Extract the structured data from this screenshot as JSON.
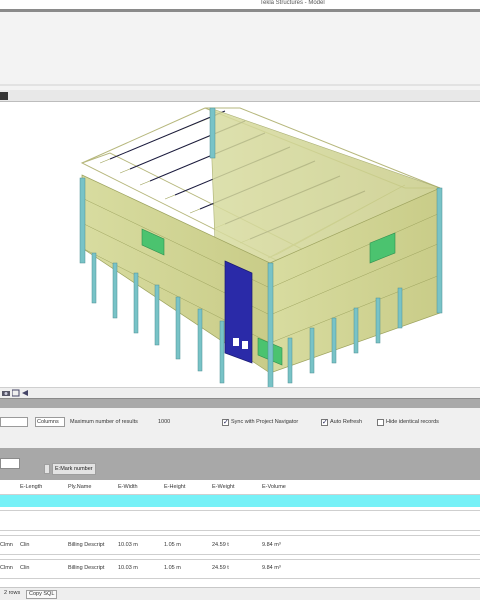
{
  "window": {
    "title": "Tekla Structures - Model"
  },
  "toolbar": {
    "columns_label": "Columns",
    "max_rows_label": "Maximum number of results",
    "max_rows_value": "1000",
    "sync_label": "Sync with Project Navigator",
    "sync_checked": true,
    "auto_refresh_label": "Auto Refresh",
    "auto_refresh_checked": true,
    "hide_identical_label": "Hide identical records",
    "hide_identical_checked": false
  },
  "grouping": {
    "chip_label": "E:Mark number"
  },
  "columns": [
    {
      "label": "E-Length"
    },
    {
      "label": "Ply.Name"
    },
    {
      "label": "E-Width"
    },
    {
      "label": "E-Height"
    },
    {
      "label": "E-Weight"
    },
    {
      "label": "E-Volume"
    }
  ],
  "rows": [
    {
      "col0": "Clmn",
      "col1": "Clin",
      "col2": "Billing Descript",
      "col3": "10.03 m",
      "col4": "1.05 m",
      "col5": "24.59 t",
      "col6": "9.84 m³"
    },
    {
      "col0": "Clmn",
      "col1": "Clin",
      "col2": "Billing Descript",
      "col3": "10.03 m",
      "col4": "1.05 m",
      "col5": "24.59 t",
      "col6": "9.84 m³"
    }
  ],
  "status": {
    "rows_count": "2 rows",
    "copy_sql_label": "Copy SQL"
  },
  "colors": {
    "frame_panel": "#d6d99a",
    "frame_edge": "#9da35e",
    "column": "#78c3c7",
    "blue_panel": "#2a2aa8",
    "green_panel": "#4bc36f",
    "filter_row": "#77f1f7"
  },
  "icons": {
    "vp_tool_1": "camera-icon",
    "vp_tool_2": "view-icon",
    "vp_tool_3": "arrow-icon"
  }
}
